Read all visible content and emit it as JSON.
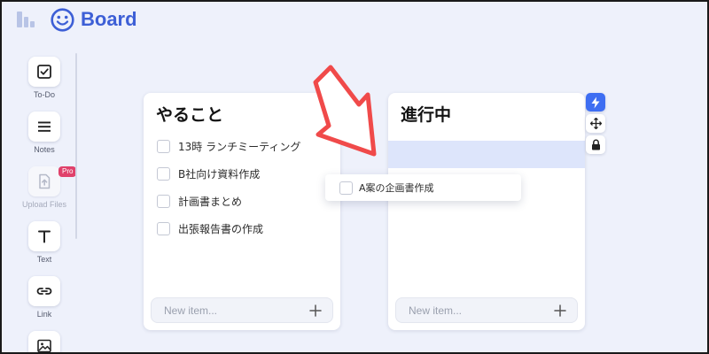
{
  "app": {
    "brand": "Board"
  },
  "colors": {
    "accent": "#3d5fd6",
    "active_button": "#3e6ef2",
    "pro_badge": "#e0416b",
    "drop_zone": "#dde5fb",
    "annotation_arrow": "#f04a4a"
  },
  "header_icons": [
    "layout-icon",
    "smiley-icon"
  ],
  "sidebar": {
    "items": [
      {
        "label": "To-Do",
        "icon": "checkbox-icon"
      },
      {
        "label": "Notes",
        "icon": "menu-lines-icon"
      },
      {
        "label": "Upload Files",
        "icon": "file-upload-icon",
        "badge": "Pro",
        "disabled": true
      },
      {
        "label": "Text",
        "icon": "text-t-icon"
      },
      {
        "label": "Link",
        "icon": "link-icon"
      },
      {
        "label": "",
        "icon": "image-icon"
      }
    ]
  },
  "columns": [
    {
      "title": "やること",
      "items": [
        "13時 ランチミーティング",
        "B社向け資料作成",
        "計画書まとめ",
        "出張報告書の作成"
      ],
      "new_item_placeholder": "New item..."
    },
    {
      "title": "進行中",
      "items": [],
      "new_item_placeholder": "New item..."
    }
  ],
  "dragging_card": {
    "text": "A案の企画書作成"
  },
  "column_toolbar": [
    "lightning-icon",
    "move-icon",
    "lock-icon"
  ]
}
